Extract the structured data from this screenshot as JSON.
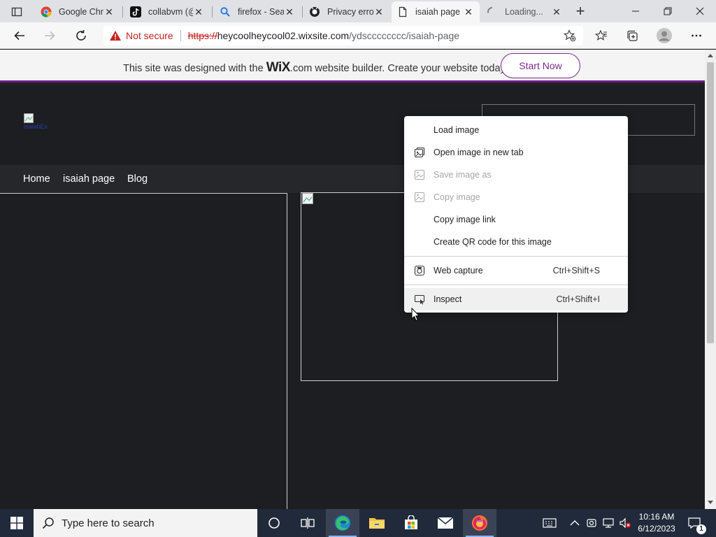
{
  "browser": {
    "tabs": [
      {
        "title": "Google Chr",
        "icon": "chrome-icon",
        "active": false
      },
      {
        "title": "collabvm (@",
        "icon": "tiktok-icon",
        "active": false
      },
      {
        "title": "firefox - Sea",
        "icon": "search-icon",
        "active": false
      },
      {
        "title": "Privacy erro",
        "icon": "github-icon",
        "active": false
      },
      {
        "title": "isaiah page",
        "icon": "page-icon",
        "active": true
      },
      {
        "title": "Loading...",
        "icon": "loading-spinner-icon",
        "active": false
      }
    ],
    "address": {
      "security_label": "Not secure",
      "url_scheme": "https://",
      "url_host": "heycoolheycool02.wixsite.com",
      "url_path": "/ydscccccccc/isaiah-page"
    }
  },
  "wix_banner": {
    "text_before": "This site was designed with the",
    "logo": "WiX",
    "text_after": ".com website builder. Create your website today.",
    "cta_label": "Start Now"
  },
  "site": {
    "logo_alt": "isaiahEx",
    "nav": [
      "Home",
      "isaiah page",
      "Blog"
    ]
  },
  "context_menu": {
    "items": [
      {
        "label": "Load image",
        "shortcut": "",
        "disabled": false,
        "icon": ""
      },
      {
        "label": "Open image in new tab",
        "shortcut": "",
        "disabled": false,
        "icon": "new-tab-icon"
      },
      {
        "label": "Save image as",
        "shortcut": "",
        "disabled": true,
        "icon": "save-image-icon"
      },
      {
        "label": "Copy image",
        "shortcut": "",
        "disabled": true,
        "icon": "copy-image-icon"
      },
      {
        "label": "Copy image link",
        "shortcut": "",
        "disabled": false,
        "icon": ""
      },
      {
        "label": "Create QR code for this image",
        "shortcut": "",
        "disabled": false,
        "icon": ""
      },
      {
        "label": "Web capture",
        "shortcut": "Ctrl+Shift+S",
        "disabled": false,
        "icon": "web-capture-icon"
      },
      {
        "label": "Inspect",
        "shortcut": "Ctrl+Shift+I",
        "disabled": false,
        "icon": "inspect-icon"
      }
    ]
  },
  "taskbar": {
    "search_placeholder": "Type here to search",
    "time": "10:16 AM",
    "date": "6/12/2023",
    "notification_count": "1"
  },
  "colors": {
    "wix_accent": "#7a2a8c",
    "page_bg": "#1d1e22",
    "not_secure": "#c5221f"
  }
}
